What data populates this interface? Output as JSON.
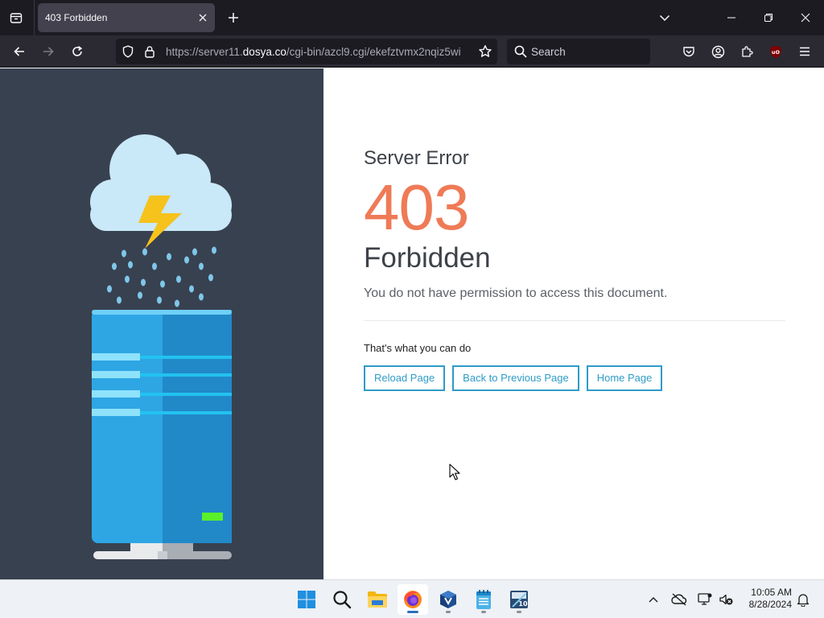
{
  "browser": {
    "tab_title": "403 Forbidden",
    "url_prefix": "https://server11.",
    "url_domain": "dosya.co",
    "url_path": "/cgi-bin/azcl9.cgi/ekefztvmx2nqiz5wi",
    "search_placeholder": "Search"
  },
  "page": {
    "kicker": "Server Error",
    "code": "403",
    "title": "Forbidden",
    "description": "You do not have permission to access this document.",
    "options_label": "That's what you can do",
    "buttons": {
      "reload": "Reload Page",
      "back": "Back to Previous Page",
      "home": "Home Page"
    },
    "accent_color": "#ef7a56",
    "button_color": "#2f9cc7"
  },
  "taskbar": {
    "time": "10:05 AM",
    "date": "8/28/2024",
    "apps": [
      "windows-start",
      "search",
      "file-explorer",
      "firefox",
      "virtualbox",
      "notepad",
      "calculator"
    ]
  }
}
